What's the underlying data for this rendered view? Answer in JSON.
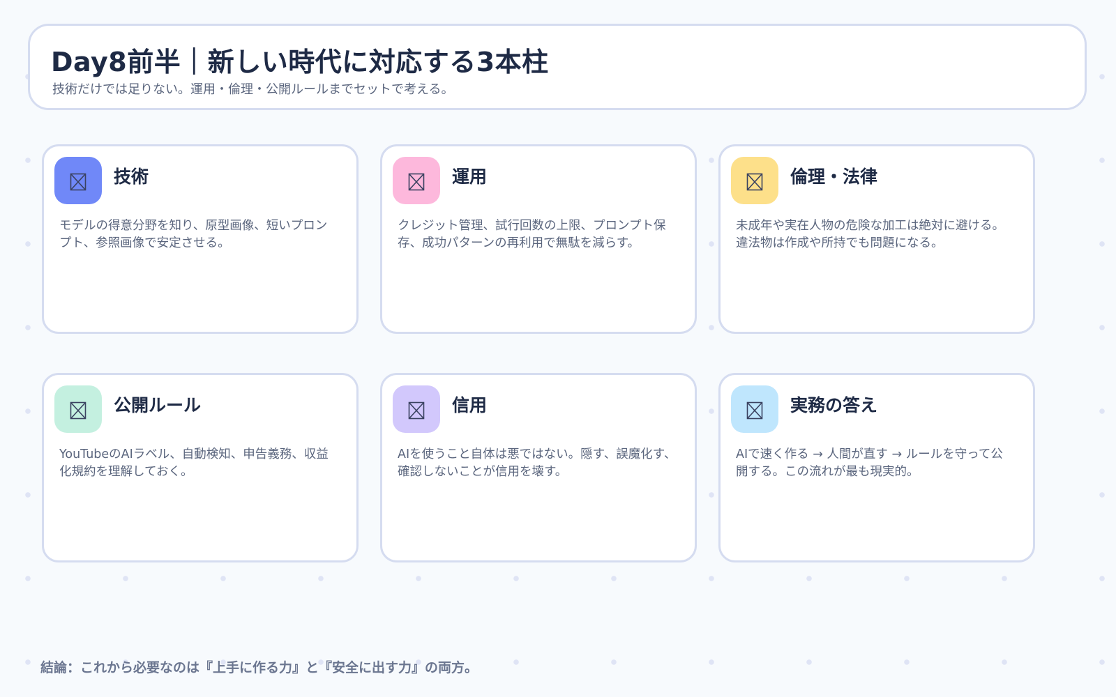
{
  "header": {
    "title": "Day8前半｜新しい時代に対応する3本柱",
    "subtitle": "技術だけでは足りない。運用・倫理・公開ルールまでセットで考える。"
  },
  "cards": [
    {
      "title": "技術",
      "description": "モデルの得意分野を知り、原型画像、短いプロンプト、参照画像で安定させる。",
      "icon": "missing-glyph-icon",
      "icon_color": "#7088f8"
    },
    {
      "title": "運用",
      "description": "クレジット管理、試行回数の上限、プロンプト保存、成功パターンの再利用で無駄を減らす。",
      "icon": "missing-glyph-icon",
      "icon_color": "#fdb8dc"
    },
    {
      "title": "倫理・法律",
      "description": "未成年や実在人物の危険な加工は絶対に避ける。違法物は作成や所持でも問題になる。",
      "icon": "missing-glyph-icon",
      "icon_color": "#fde08a"
    },
    {
      "title": "公開ルール",
      "description": "YouTubeのAIラベル、自動検知、申告義務、収益化規約を理解しておく。",
      "icon": "missing-glyph-icon",
      "icon_color": "#c4f0e0"
    },
    {
      "title": "信用",
      "description": "AIを使うこと自体は悪ではない。隠す、誤魔化す、確認しないことが信用を壊す。",
      "icon": "missing-glyph-icon",
      "icon_color": "#d2c8fc"
    },
    {
      "title": "実務の答え",
      "description": "AIで速く作る → 人間が直す → ルールを守って公開する。この流れが最も現実的。",
      "icon": "missing-glyph-icon",
      "icon_color": "#bfe6fd"
    }
  ],
  "conclusion": "結論：これから必要なのは『上手に作る力』と『安全に出す力』の両方。"
}
